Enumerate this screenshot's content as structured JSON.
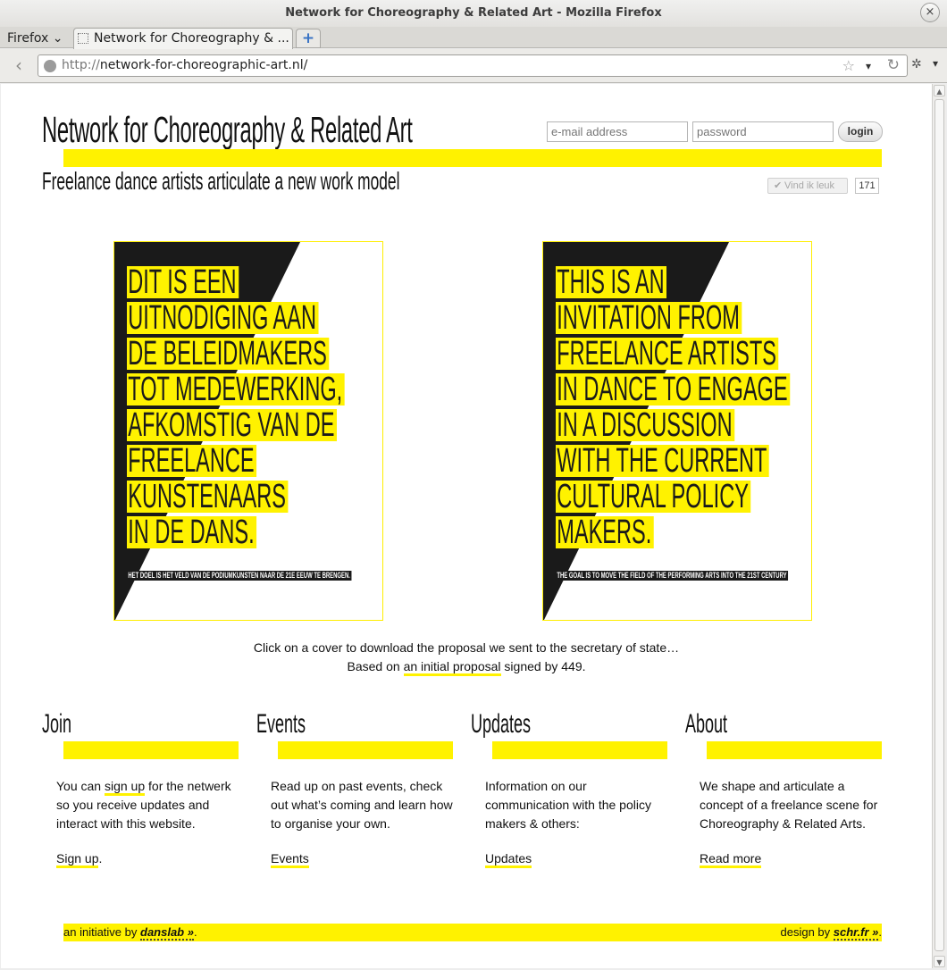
{
  "window": {
    "title": "Network for Choreography & Related Art - Mozilla Firefox",
    "close_glyph": "×"
  },
  "browser": {
    "menu_label": "Firefox",
    "tab_title": "Network for Choreography & ...",
    "new_tab_glyph": "+",
    "url_protocol": "http://",
    "url_host": "network-for-choreographic-art.nl/",
    "icons": [
      "back-arrow-icon",
      "globe-icon",
      "bookmark-star-icon",
      "url-dropdown-icon",
      "reload-icon",
      "extension-icon",
      "more-icon"
    ]
  },
  "header": {
    "site_title": "Network for Choreography & Related Art",
    "subtitle": "Freelance dance artists articulate a new work model",
    "email_placeholder": "e-mail address",
    "password_placeholder": "password",
    "login_label": "login",
    "like_label": "Vind ik leuk",
    "like_count": "171"
  },
  "covers": {
    "left": {
      "lines": [
        "DIT IS EEN",
        "UITNODIGING AAN",
        "DE BELEIDMAKERS",
        "TOT MEDEWERKING,",
        "AFKOMSTIG VAN DE",
        "FREELANCE",
        "KUNSTENAARS",
        "IN DE DANS."
      ],
      "tagline": "HET DOEL IS HET VELD VAN DE PODIUMKUNSTEN NAAR DE 21E EEUW TE BRENGEN."
    },
    "right": {
      "lines": [
        "THIS IS AN",
        "INVITATION FROM",
        "FREELANCE ARTISTS",
        "IN DANCE TO ENGAGE",
        "IN A DISCUSSION",
        "WITH THE CURRENT",
        "CULTURAL POLICY",
        "MAKERS."
      ],
      "tagline": "THE GOAL IS TO MOVE THE FIELD OF THE PERFORMING ARTS INTO THE 21ST CENTURY"
    }
  },
  "captions": {
    "line1": "Click on a cover to download the proposal we sent to the secretary of state…",
    "line2_before": "Based on ",
    "line2_link": "an initial proposal",
    "line2_after": " signed by 449."
  },
  "columns": {
    "join": {
      "heading": "Join",
      "text_before": "You can ",
      "text_link": "sign up",
      "text_after": " for the netwerk so you receive updates and interact with this website.",
      "link": "Sign up",
      "link_suffix": "."
    },
    "events": {
      "heading": "Events",
      "text": "Read up on past events, check out what’s coming and learn how to organise your own.",
      "link": "Events"
    },
    "updates": {
      "heading": "Updates",
      "text": "Information on our communication with the policy makers & others:",
      "link": "Updates"
    },
    "about": {
      "heading": "About",
      "text": "We shape and articulate a concept of a freelance scene for Choreography & Related Arts.",
      "link": "Read more"
    }
  },
  "footer": {
    "initiative_prefix": "an initiative by ",
    "initiative_name": "danslab »",
    "initiative_suffix": ".",
    "design_prefix": "design by ",
    "design_name": "schr.fr »",
    "design_suffix": "."
  },
  "colors": {
    "accent": "#fff200",
    "text": "#111111",
    "cover_dark": "#1a1a1a"
  }
}
